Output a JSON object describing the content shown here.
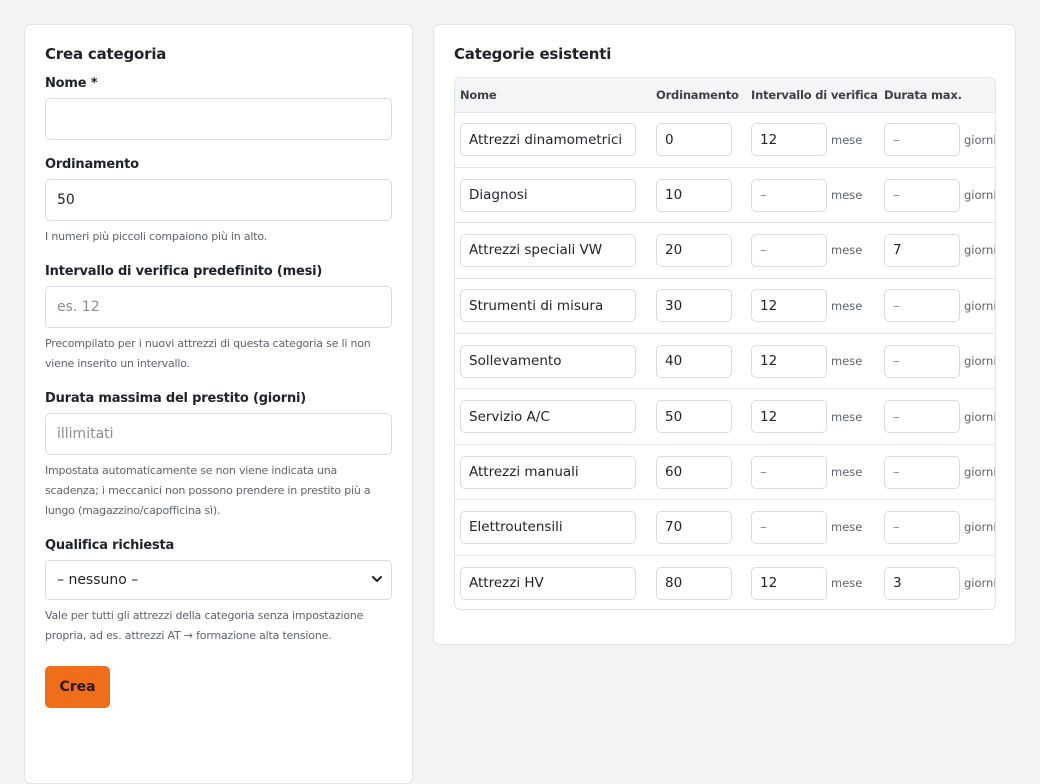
{
  "create": {
    "title": "Crea categoria",
    "name_label": "Nome *",
    "name_value": "",
    "order_label": "Ordinamento",
    "order_value": "50",
    "order_help": "I numeri più piccoli compaiono più in alto.",
    "interval_label": "Intervallo di verifica predefinito (mesi)",
    "interval_placeholder": "es. 12",
    "interval_help": "Precompilato per i nuovi attrezzi di questa categoria se li non viene inserito un intervallo.",
    "loan_label": "Durata massima del prestito (giorni)",
    "loan_placeholder": "illimitati",
    "loan_help": "Impostata automaticamente se non viene indicata una scadenza; i meccanici non possono prendere in prestito più a lungo (magazzino/capofficina sì).",
    "qual_label": "Qualifica richiesta",
    "qual_selected": "– nessuno –",
    "qual_help": "Vale per tutti gli attrezzi della categoria senza impostazione propria, ad es. attrezzi AT → formazione alta tensione.",
    "submit_label": "Crea"
  },
  "list": {
    "title": "Categorie esistenti",
    "headers": {
      "name": "Nome",
      "order": "Ordinamento",
      "interval": "Intervallo di verifica",
      "loan": "Durata max."
    },
    "unit_month": "mese",
    "unit_days": "giorni",
    "empty_placeholder": "–",
    "rows": [
      {
        "name": "Attrezzi dinamometrici",
        "order": "0",
        "interval": "12",
        "loan": ""
      },
      {
        "name": "Diagnosi",
        "order": "10",
        "interval": "",
        "loan": ""
      },
      {
        "name": "Attrezzi speciali VW",
        "order": "20",
        "interval": "",
        "loan": "7"
      },
      {
        "name": "Strumenti di misura",
        "order": "30",
        "interval": "12",
        "loan": ""
      },
      {
        "name": "Sollevamento",
        "order": "40",
        "interval": "12",
        "loan": ""
      },
      {
        "name": "Servizio A/C",
        "order": "50",
        "interval": "12",
        "loan": ""
      },
      {
        "name": "Attrezzi manuali",
        "order": "60",
        "interval": "",
        "loan": ""
      },
      {
        "name": "Elettroutensili",
        "order": "70",
        "interval": "",
        "loan": ""
      },
      {
        "name": "Attrezzi HV",
        "order": "80",
        "interval": "12",
        "loan": "3"
      }
    ]
  },
  "colors": {
    "accent": "#f06d1a",
    "background": "#f2f3f5",
    "card": "#ffffff",
    "border": "#e3e5e8"
  }
}
